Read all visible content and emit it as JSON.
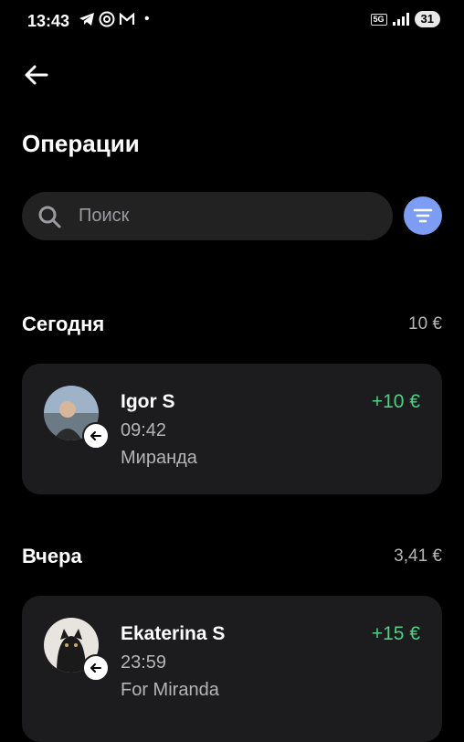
{
  "status_bar": {
    "time": "13:43",
    "network": "5G",
    "battery": "31",
    "dot": "•"
  },
  "page": {
    "title": "Операции"
  },
  "search": {
    "placeholder": "Поиск"
  },
  "sections": [
    {
      "label": "Сегодня",
      "total": "10 €",
      "transactions": [
        {
          "name": "Igor S",
          "time": "09:42",
          "note": "Миранда",
          "amount": "+10 €"
        }
      ]
    },
    {
      "label": "Вчера",
      "total": "3,41 €",
      "transactions": [
        {
          "name": "Ekaterina S",
          "time": "23:59",
          "note": "For Miranda",
          "amount": "+15 €"
        }
      ]
    }
  ],
  "colors": {
    "accent": "#7d9cf3",
    "positive": "#4fcf84",
    "card": "#1c1c1e"
  },
  "icons": [
    "telegram-icon",
    "at-icon",
    "gmail-icon",
    "back-arrow-icon",
    "search-icon",
    "filter-icon",
    "incoming-transfer-icon"
  ]
}
